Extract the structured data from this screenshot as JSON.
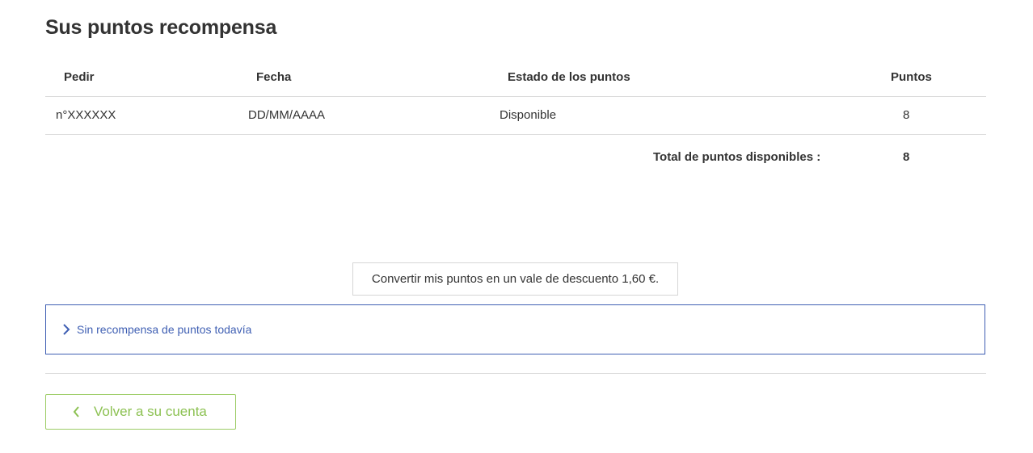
{
  "page": {
    "title": "Sus puntos recompensa"
  },
  "table": {
    "headers": {
      "pedir": "Pedir",
      "fecha": "Fecha",
      "estado": "Estado de los puntos",
      "puntos": "Puntos"
    },
    "rows": [
      {
        "pedir": "n°XXXXXX",
        "fecha": "DD/MM/AAAA",
        "estado": "Disponible",
        "puntos": "8"
      }
    ],
    "total": {
      "label": "Total de puntos disponibles :",
      "value": "8"
    }
  },
  "convert_button": {
    "label": "Convertir mis puntos en un vale de descuento 1,60 €."
  },
  "accordion": {
    "label": "Sin recompensa de puntos todavía",
    "icon": "chevron-right-icon"
  },
  "back_button": {
    "label": "Volver a su cuenta",
    "icon": "chevron-left-icon"
  },
  "colors": {
    "accordion": "#3f5fb3",
    "back": "#8cc152",
    "border": "#dcdcdc"
  }
}
